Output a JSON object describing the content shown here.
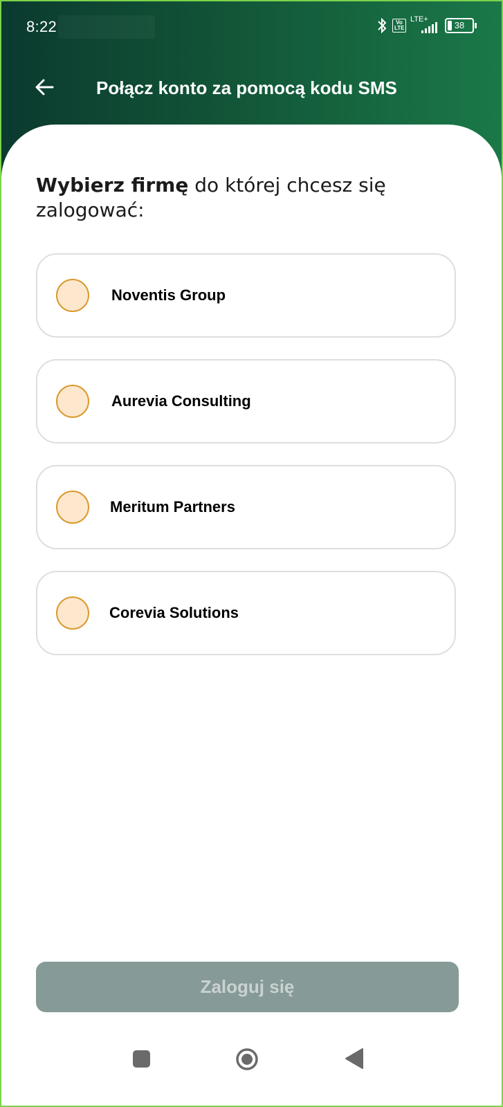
{
  "status_bar": {
    "time": "8:22",
    "network": "LTE+",
    "volte": "Vo LTE",
    "battery": "38"
  },
  "header": {
    "title": "Połącz konto za pomocą kodu SMS",
    "back_icon": "arrow-left-icon"
  },
  "prompt": {
    "bold": "Wybierz firmę",
    "rest": " do której chcesz się zalogować:"
  },
  "companies": [
    {
      "name": "Noventis Group",
      "selected": false
    },
    {
      "name": "Aurevia Consulting",
      "selected": false
    },
    {
      "name": "Meritum Partners",
      "selected": false
    },
    {
      "name": "Corevia Solutions",
      "selected": false
    }
  ],
  "login_button": {
    "label": "Zaloguj się",
    "enabled": false
  },
  "nav": {
    "recent": "square-icon",
    "home": "circle-icon",
    "back": "triangle-back-icon"
  },
  "colors": {
    "header_start": "#0b3a2f",
    "header_end": "#1a7848",
    "radio_fill": "#fde7cd",
    "radio_border": "#d99a2e",
    "button_disabled": "#869a98",
    "frame_border": "#7bd44a"
  }
}
